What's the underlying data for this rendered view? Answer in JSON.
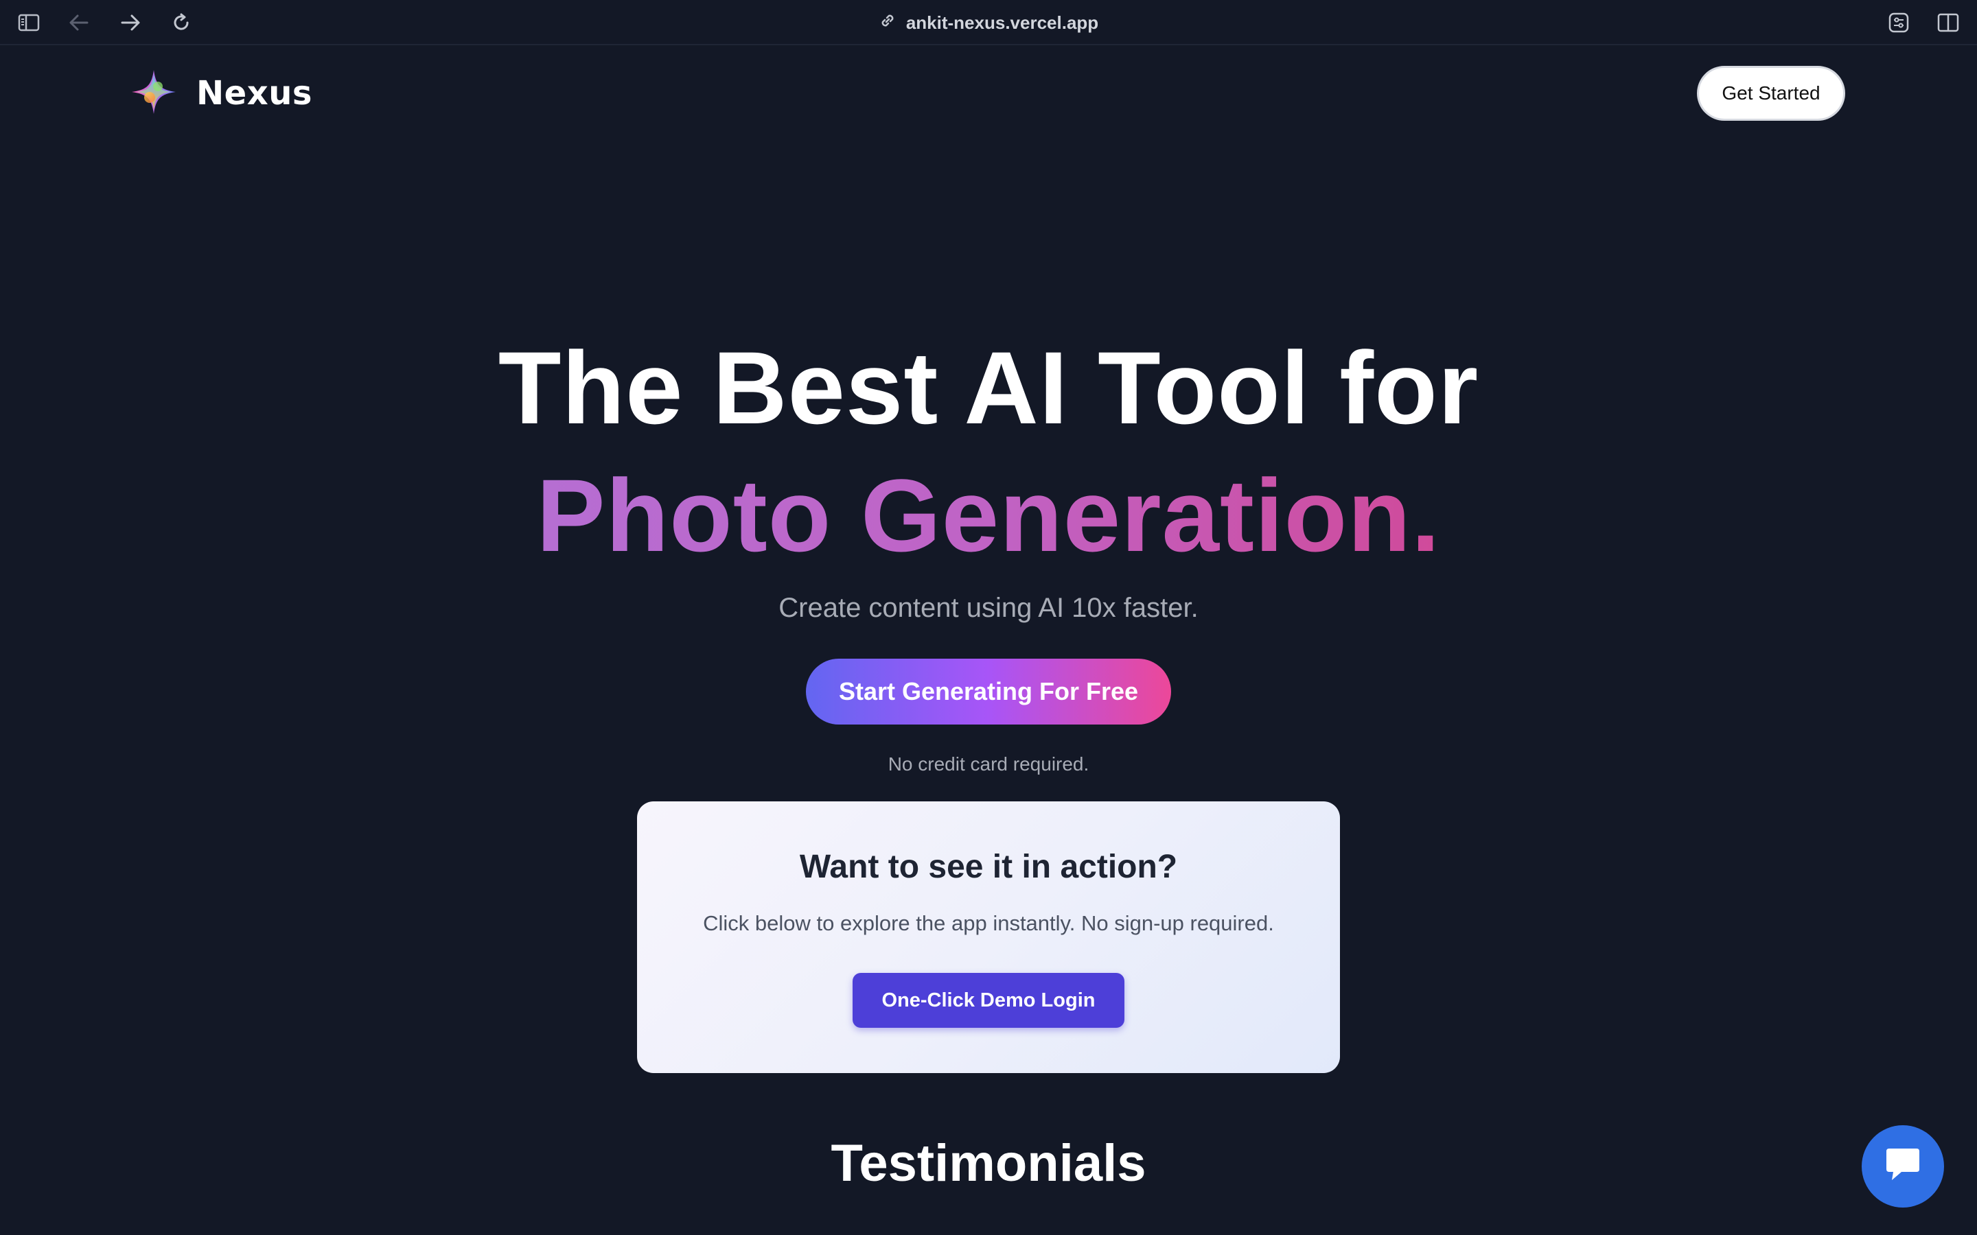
{
  "browser": {
    "url": "ankit-nexus.vercel.app"
  },
  "nav": {
    "brand": "Nexus",
    "get_started_label": "Get Started"
  },
  "hero": {
    "title_line1": "The Best AI Tool for",
    "title_line2": "Photo Generation.",
    "subtitle": "Create content using AI 10x faster.",
    "cta_label": "Start Generating For Free",
    "note": "No credit card required."
  },
  "demo": {
    "title": "Want to see it in action?",
    "subtitle": "Click below to explore the app instantly. No sign-up required.",
    "button_label": "One-Click Demo Login"
  },
  "sections": {
    "testimonials_heading": "Testimonials"
  },
  "icons": {
    "sidebar": "sidebar-toggle-icon",
    "back": "arrow-left-icon",
    "forward": "arrow-right-icon",
    "reload": "reload-icon",
    "link": "link-icon",
    "extension": "extension-icon",
    "split_view": "split-view-icon",
    "logo": "sparkle-logo-icon",
    "chat": "chat-bubble-icon"
  },
  "colors": {
    "background": "#131826",
    "gradient_start": "#6366f1",
    "gradient_mid": "#a855f7",
    "gradient_end": "#ec4899",
    "demo_button": "#4d3fd8",
    "chat_button": "#2f6fe4"
  }
}
